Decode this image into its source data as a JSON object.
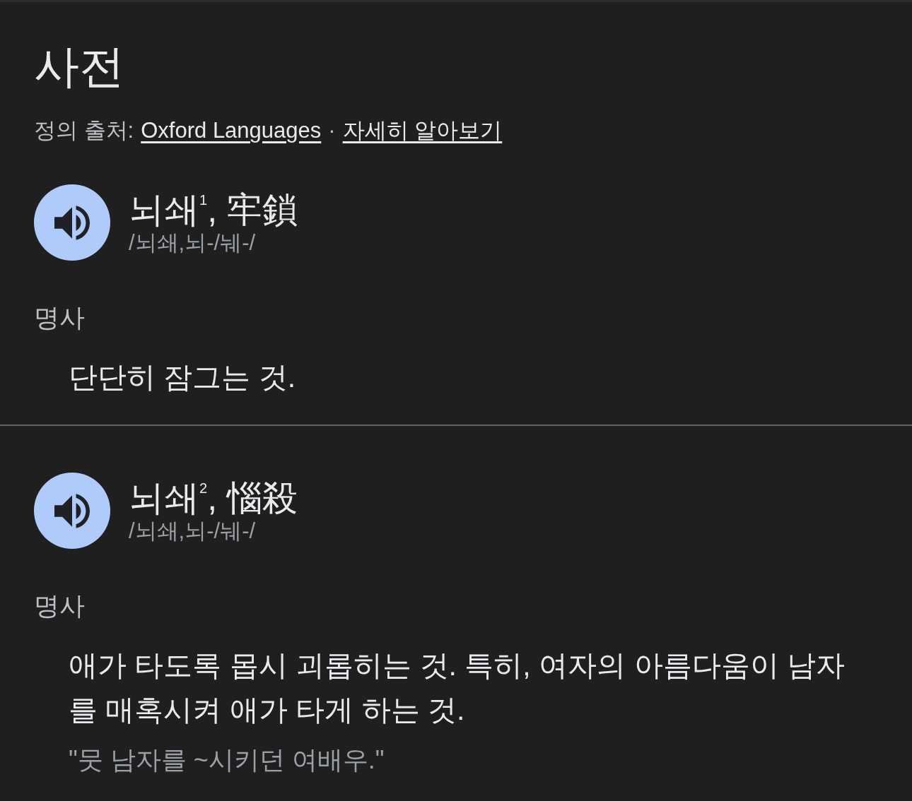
{
  "title": "사전",
  "source": {
    "label": "정의 출처:",
    "links": [
      {
        "text": "Oxford Languages"
      },
      {
        "text": "자세히 알아보기"
      }
    ],
    "separator": "·"
  },
  "entries": [
    {
      "headword": "뇌쇄$^{1}$, 牢鎖",
      "pronunciation": "/뇌쇄,뇌-/눼-/",
      "part_of_speech": "명사",
      "definitions": [
        {
          "text": "단단히 잠그는 것."
        }
      ]
    },
    {
      "headword": "뇌쇄$^{2}$, 惱殺",
      "pronunciation": "/뇌쇄,뇌-/눼-/",
      "part_of_speech": "명사",
      "definitions": [
        {
          "text": "애가 타도록 몹시 괴롭히는 것. 특히, 여자의 아름다움이 남자를 매혹시켜 애가 타게 하는 것.",
          "example": "\"뭇 남자를 ~시키던 여배우.\""
        }
      ]
    }
  ]
}
